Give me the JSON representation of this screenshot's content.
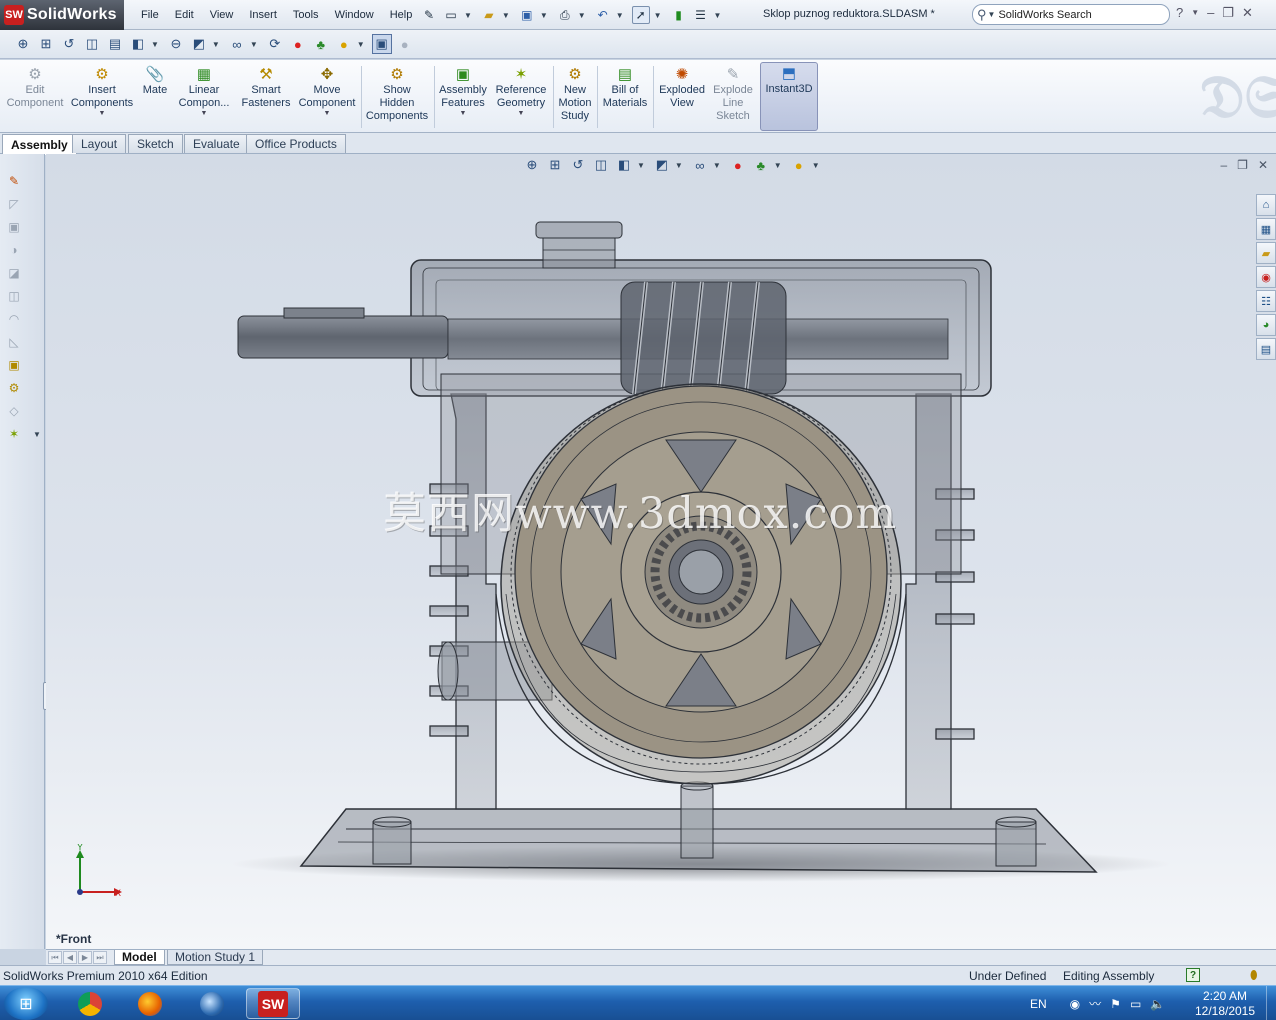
{
  "app": {
    "name": "SolidWorks",
    "logo_text": "SW",
    "document_title": "Sklop puznog reduktora.SLDASM *"
  },
  "menu": [
    "File",
    "Edit",
    "View",
    "Insert",
    "Tools",
    "Window",
    "Help"
  ],
  "search": {
    "value": "SolidWorks Search"
  },
  "command_manager": [
    {
      "label": "Edit\nComponent",
      "icon": "edit-component-icon"
    },
    {
      "label": "Insert\nComponents",
      "icon": "insert-components-icon"
    },
    {
      "label": "Mate",
      "icon": "mate-icon"
    },
    {
      "label": "Linear\nCompon...",
      "icon": "linear-pattern-icon"
    },
    {
      "label": "Smart\nFasteners",
      "icon": "smart-fasteners-icon"
    },
    {
      "label": "Move\nComponent",
      "icon": "move-component-icon"
    },
    {
      "label": "Show\nHidden\nComponents",
      "icon": "show-hidden-icon"
    },
    {
      "label": "Assembly\nFeatures",
      "icon": "assembly-features-icon"
    },
    {
      "label": "Reference\nGeometry",
      "icon": "reference-geometry-icon"
    },
    {
      "label": "New\nMotion\nStudy",
      "icon": "motion-study-icon"
    },
    {
      "label": "Bill of\nMaterials",
      "icon": "bom-icon"
    },
    {
      "label": "Exploded\nView",
      "icon": "exploded-view-icon"
    },
    {
      "label": "Explode\nLine\nSketch",
      "icon": "explode-line-icon"
    },
    {
      "label": "Instant3D",
      "icon": "instant3d-icon"
    }
  ],
  "tabs": [
    "Assembly",
    "Layout",
    "Sketch",
    "Evaluate",
    "Office Products"
  ],
  "viewport": {
    "view_label": "*Front",
    "watermark": "莫西网www.3dmox.com",
    "axis_x": "X",
    "axis_y": "Y"
  },
  "model_tabs": [
    "Model",
    "Motion Study 1"
  ],
  "status": {
    "edition": "SolidWorks Premium 2010 x64 Edition",
    "state": "Under Defined",
    "mode": "Editing Assembly"
  },
  "taskbar": {
    "language": "EN",
    "time": "2:20 AM",
    "date": "12/18/2015"
  },
  "colors": {
    "viewport_top": "#d3dbe6",
    "housing": "#6f7580",
    "gear": "#9b9384",
    "accent": "#c8201f"
  }
}
